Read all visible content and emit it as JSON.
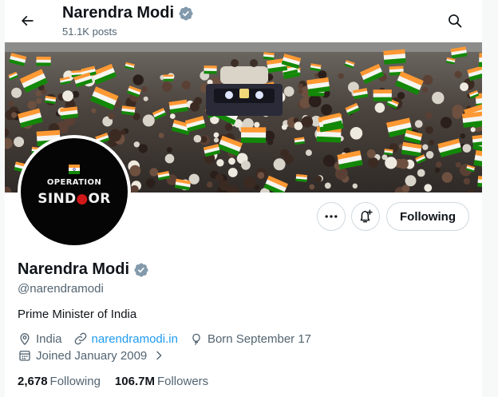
{
  "header": {
    "name": "Narendra Modi",
    "posts_count": "51.1K posts"
  },
  "avatar": {
    "line1": "OPERATION",
    "line2_start": "SIND",
    "line2_mark": "●",
    "line2_end": "OR"
  },
  "actions": {
    "follow_label": "Following"
  },
  "profile": {
    "name": "Narendra Modi",
    "handle": "@narendramodi",
    "bio": "Prime Minister of India",
    "location": "India",
    "website": "narendramodi.in",
    "birthday": "Born September 17",
    "joined": "Joined January 2009"
  },
  "stats": {
    "following_count": "2,678",
    "following_label": "Following",
    "followers_count": "106.7M",
    "followers_label": "Followers"
  },
  "colors": {
    "verified_badge": "#829aab",
    "link": "#1d9bf0",
    "secondary_text": "#536471",
    "saffron": "#ff9933",
    "green": "#138808"
  },
  "icons": {
    "back": "back-arrow-icon",
    "search": "search-icon",
    "more": "more-icon",
    "notify": "bell-plus-icon",
    "verified": "verified-badge-icon",
    "location": "location-pin-icon",
    "link": "link-icon",
    "birthday": "balloon-icon",
    "calendar": "calendar-icon",
    "chevron": "chevron-right-icon"
  }
}
